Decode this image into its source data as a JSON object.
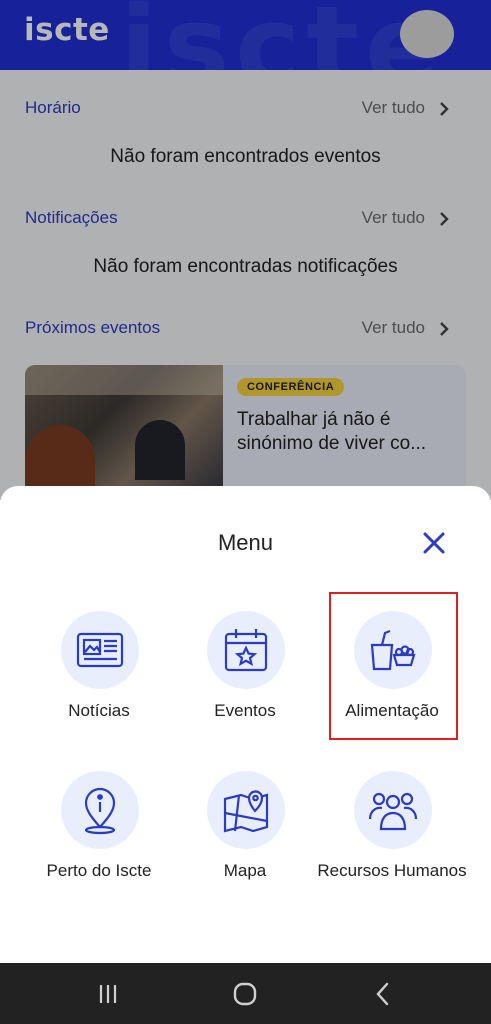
{
  "header": {
    "logo": "iscte",
    "bg_word": "iscte"
  },
  "sections": [
    {
      "title": "Horário",
      "link": "Ver tudo",
      "empty": "Não foram encontrados eventos"
    },
    {
      "title": "Notificações",
      "link": "Ver tudo",
      "empty": "Não foram encontradas notificações"
    },
    {
      "title": "Próximos eventos",
      "link": "Ver tudo"
    }
  ],
  "event": {
    "tag": "CONFERÊNCIA",
    "title": "Trabalhar já não é sinónimo de viver co..."
  },
  "menu": {
    "title": "Menu",
    "items": [
      {
        "label": "Notícias",
        "icon": "newspaper-icon"
      },
      {
        "label": "Eventos",
        "icon": "calendar-star-icon"
      },
      {
        "label": "Alimentação",
        "icon": "food-drink-icon"
      },
      {
        "label": "Perto do Iscte",
        "icon": "location-pin-icon"
      },
      {
        "label": "Mapa",
        "icon": "map-icon"
      },
      {
        "label": "Recursos Humanos",
        "icon": "people-icon"
      }
    ]
  },
  "colors": {
    "brand": "#1f2fd6",
    "accent_text": "#2a3bc7",
    "tag": "#f6d23c",
    "highlight": "#e0201f"
  },
  "navbar": [
    "recent-apps-icon",
    "home-icon",
    "back-icon"
  ]
}
